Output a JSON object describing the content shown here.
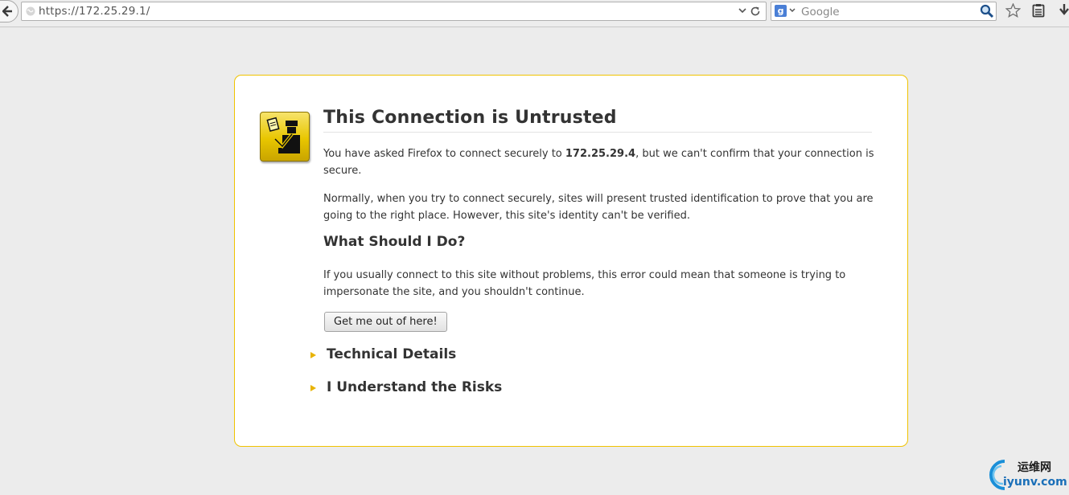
{
  "browser": {
    "url": "https://172.25.29.1/",
    "search_placeholder": "Google",
    "search_engine_glyph": "g"
  },
  "icons": {
    "back": "back-arrow-icon",
    "globe": "globe-icon",
    "dropmarker": "chevron-down-icon",
    "reload": "reload-icon",
    "search": "magnifier-icon",
    "bookmark": "star-icon",
    "bookmarks_menu": "clipboard-icon",
    "downloads": "download-arrow-icon",
    "certificate": "officer-certificate-icon"
  },
  "error": {
    "title": "This Connection is Untrusted",
    "p1_before": "You have asked Firefox to connect securely to ",
    "p1_host": "172.25.29.4",
    "p1_after": ", but we can't confirm that your connection is secure.",
    "p2": "Normally, when you try to connect securely, sites will present trusted identification to prove that you are going to the right place. However, this site's identity can't be verified.",
    "what_title": "What Should I Do?",
    "p3": "If you usually connect to this site without problems, this error could mean that someone is trying to impersonate the site, and you shouldn't continue.",
    "button": "Get me out of here!",
    "expanders": [
      "Technical Details",
      "I Understand the Risks"
    ]
  },
  "watermark": {
    "cn": "运维网",
    "domain": "iyunv.com"
  },
  "colors": {
    "accent": "#f0c300",
    "background": "#ececec",
    "watermark_blue": "#1a8fd8"
  }
}
